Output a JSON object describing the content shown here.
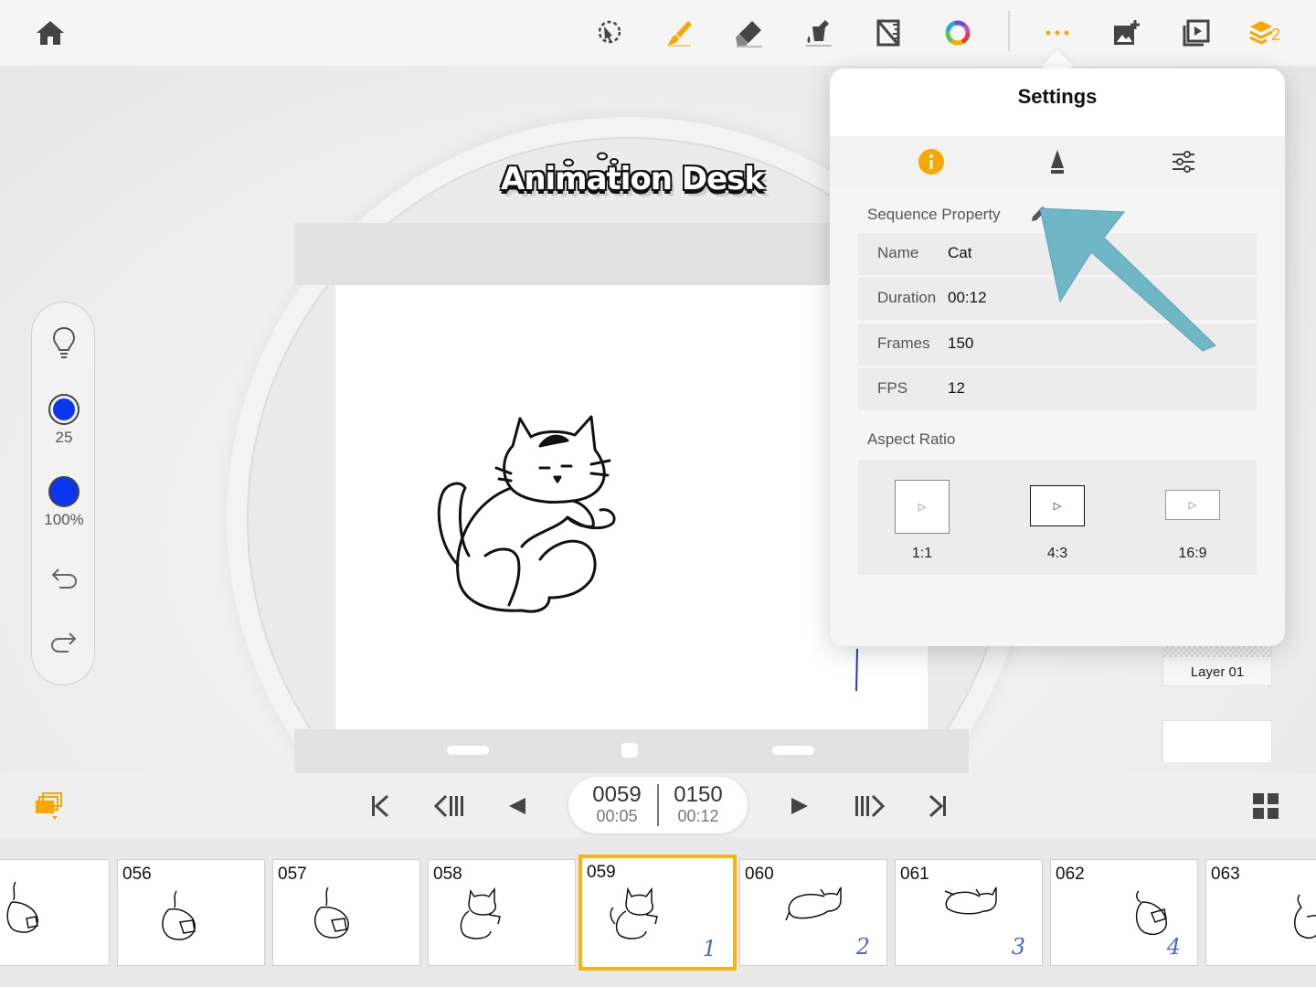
{
  "toolbar": {
    "home_icon": "home-icon",
    "tools": [
      "lasso-select-icon",
      "brush-icon",
      "eraser-icon",
      "fill-bucket-icon",
      "ruler-icon",
      "color-wheel-icon"
    ],
    "more_icon": "more-dots-icon",
    "add_image_icon": "add-image-icon",
    "play_preview_icon": "play-preview-icon",
    "layers_icon": "layers-icon",
    "layers_count": "2",
    "accent_color": "#f7a800"
  },
  "stage": {
    "logo_text": "Animation Desk"
  },
  "side_panel": {
    "brush_size": "25",
    "opacity": "100%",
    "brush_color": "#0a36f0"
  },
  "layers": {
    "layer_name": "Layer 01"
  },
  "settings": {
    "title": "Settings",
    "tabs": [
      "info-icon",
      "pen-nib-icon",
      "sliders-icon"
    ],
    "sequence_property_title": "Sequence Property",
    "properties": [
      {
        "label": "Name",
        "value": "Cat"
      },
      {
        "label": "Duration",
        "value": "00:12"
      },
      {
        "label": "Frames",
        "value": "150"
      },
      {
        "label": "FPS",
        "value": "12"
      }
    ],
    "aspect_ratio_title": "Aspect Ratio",
    "ratios": [
      "1:1",
      "4:3",
      "16:9"
    ],
    "selected_ratio": "4:3"
  },
  "playback": {
    "current_frame": "0059",
    "current_time": "00:05",
    "total_frames": "0150",
    "total_time": "00:12"
  },
  "filmstrip": {
    "frames": [
      {
        "number": "",
        "mark": ""
      },
      {
        "number": "056",
        "mark": ""
      },
      {
        "number": "057",
        "mark": ""
      },
      {
        "number": "058",
        "mark": ""
      },
      {
        "number": "059",
        "mark": "1"
      },
      {
        "number": "060",
        "mark": "2"
      },
      {
        "number": "061",
        "mark": "3"
      },
      {
        "number": "062",
        "mark": "4"
      },
      {
        "number": "063",
        "mark": ""
      }
    ],
    "selected_index": 4,
    "selected_color": "#f7b413"
  },
  "annotation_color": "#6fb7c6"
}
